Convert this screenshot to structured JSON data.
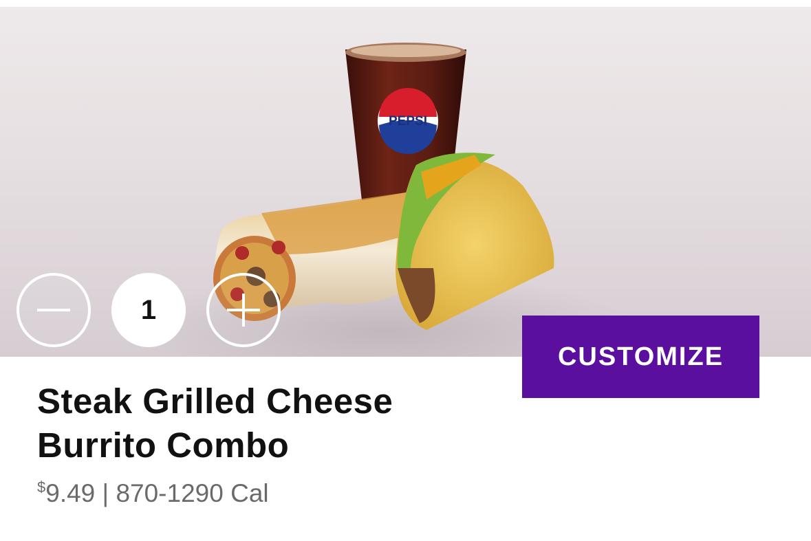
{
  "product": {
    "name_line1": "Steak Grilled Cheese",
    "name_line2": "Burrito Combo",
    "currency_symbol": "$",
    "price": "9.49",
    "separator": "|",
    "calories": "870-1290 Cal",
    "image": {
      "cup_label": "PEPSI",
      "items": [
        "drink-cup-icon",
        "burrito-icon",
        "taco-icon"
      ]
    }
  },
  "quantity": {
    "value": "1",
    "decrease_icon": "minus-icon",
    "increase_icon": "plus-icon"
  },
  "actions": {
    "customize_label": "CUSTOMIZE"
  },
  "colors": {
    "accent": "#5a0f9e",
    "title": "#111111",
    "meta": "#6a6a6a"
  }
}
